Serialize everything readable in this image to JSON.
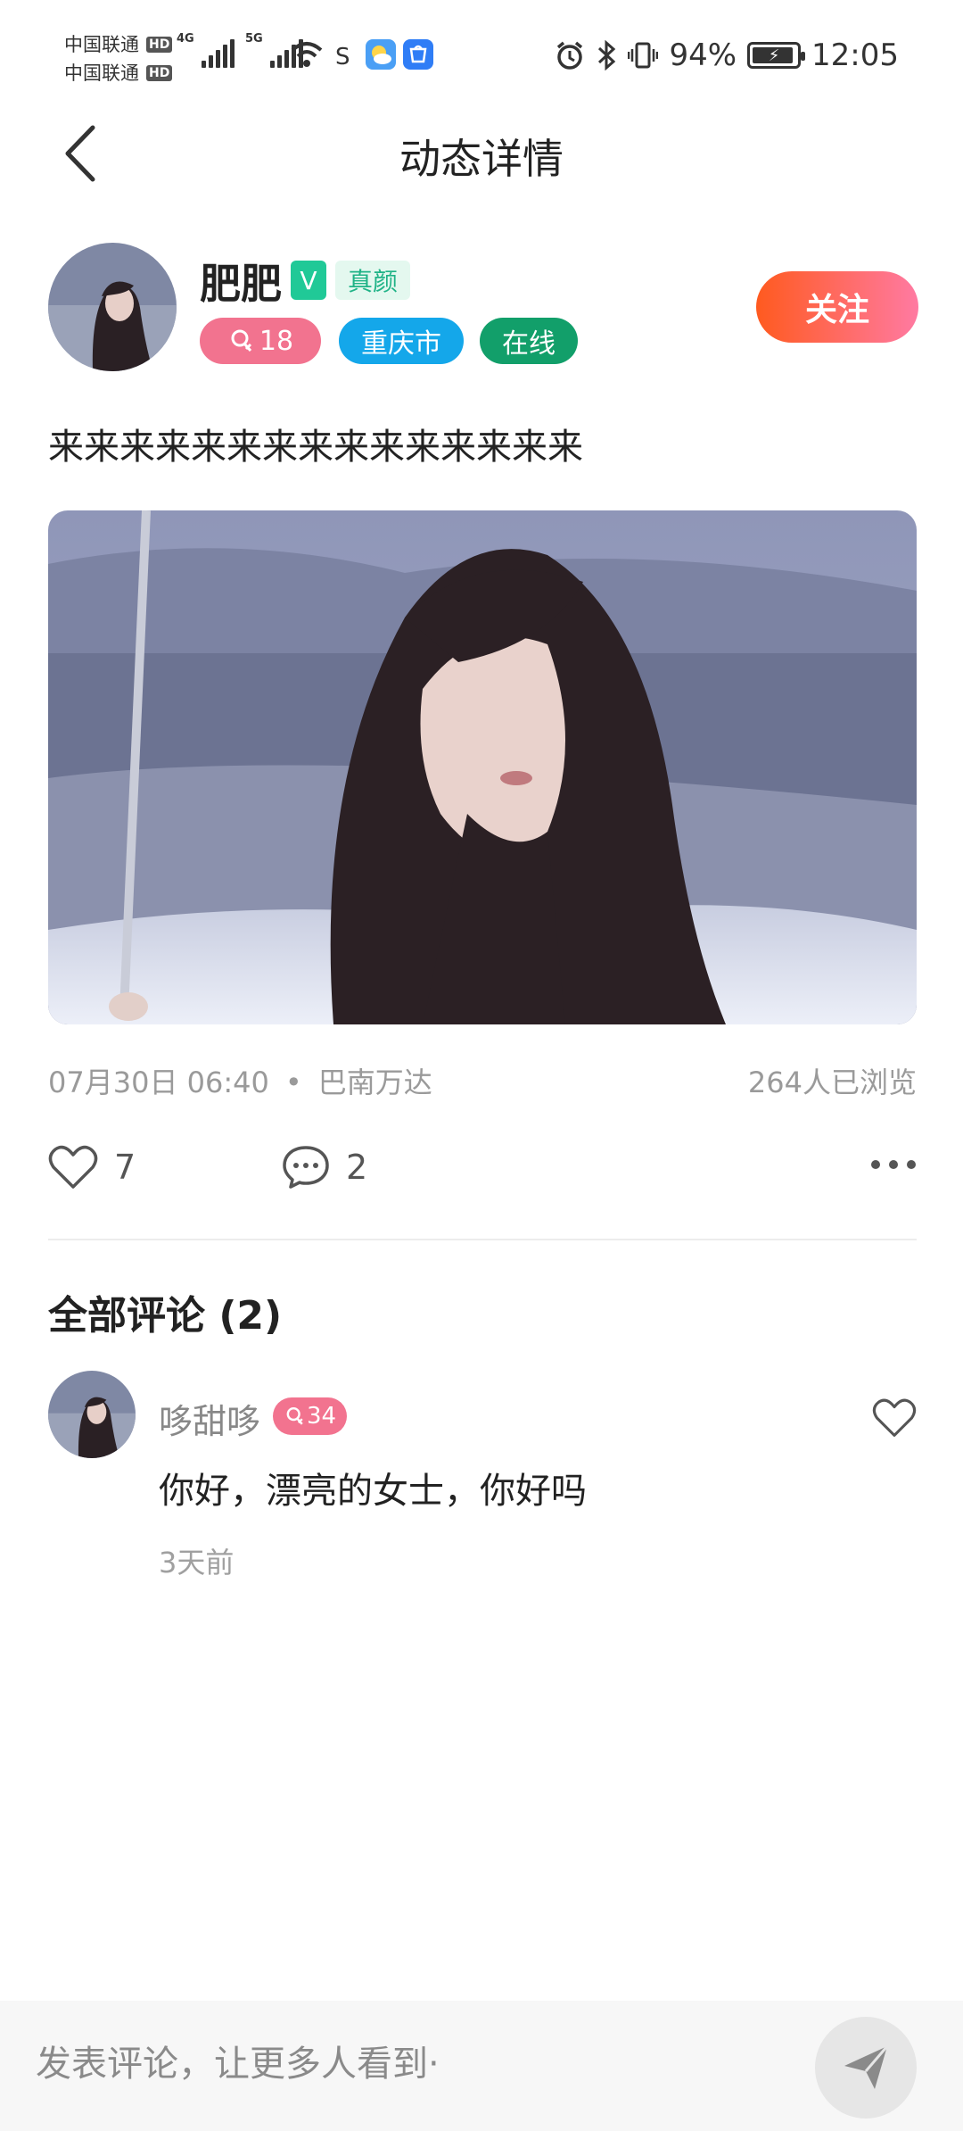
{
  "status_bar": {
    "carrier1": "中国联通",
    "carrier2": "中国联通",
    "hd": "HD",
    "net1": "4G",
    "net2": "5G",
    "battery_percent": "94%",
    "time": "12:05",
    "battery_level": 0.94
  },
  "header": {
    "title": "动态详情",
    "back_icon": "chevron-left-icon"
  },
  "profile": {
    "name": "肥肥",
    "verified_badge": "V",
    "real_face_tag": "真颜",
    "gender_age": "18",
    "city": "重庆市",
    "online": "在线",
    "follow_label": "关注"
  },
  "post": {
    "text": "来来来来来来来来来来来来来来来",
    "datetime": "07月30日 06:40",
    "dot": "•",
    "location": "巴南万达",
    "views": "264人已浏览",
    "likes": "7",
    "comments": "2"
  },
  "comments_section": {
    "heading": "全部评论 (2)",
    "items": [
      {
        "name": "哆甜哆",
        "gender_age": "34",
        "text": "你好，漂亮的女士，你好吗",
        "time": "3天前"
      }
    ]
  },
  "bottom_bar": {
    "placeholder": "发表评论，让更多人看到·"
  },
  "colors": {
    "follow_gradient_start": "#ff5a1f",
    "follow_gradient_end": "#ff7aa2",
    "gender_pill": "#f2738f",
    "city_pill": "#14a7ea",
    "online_pill": "#129f6a",
    "verified": "#20c997"
  }
}
